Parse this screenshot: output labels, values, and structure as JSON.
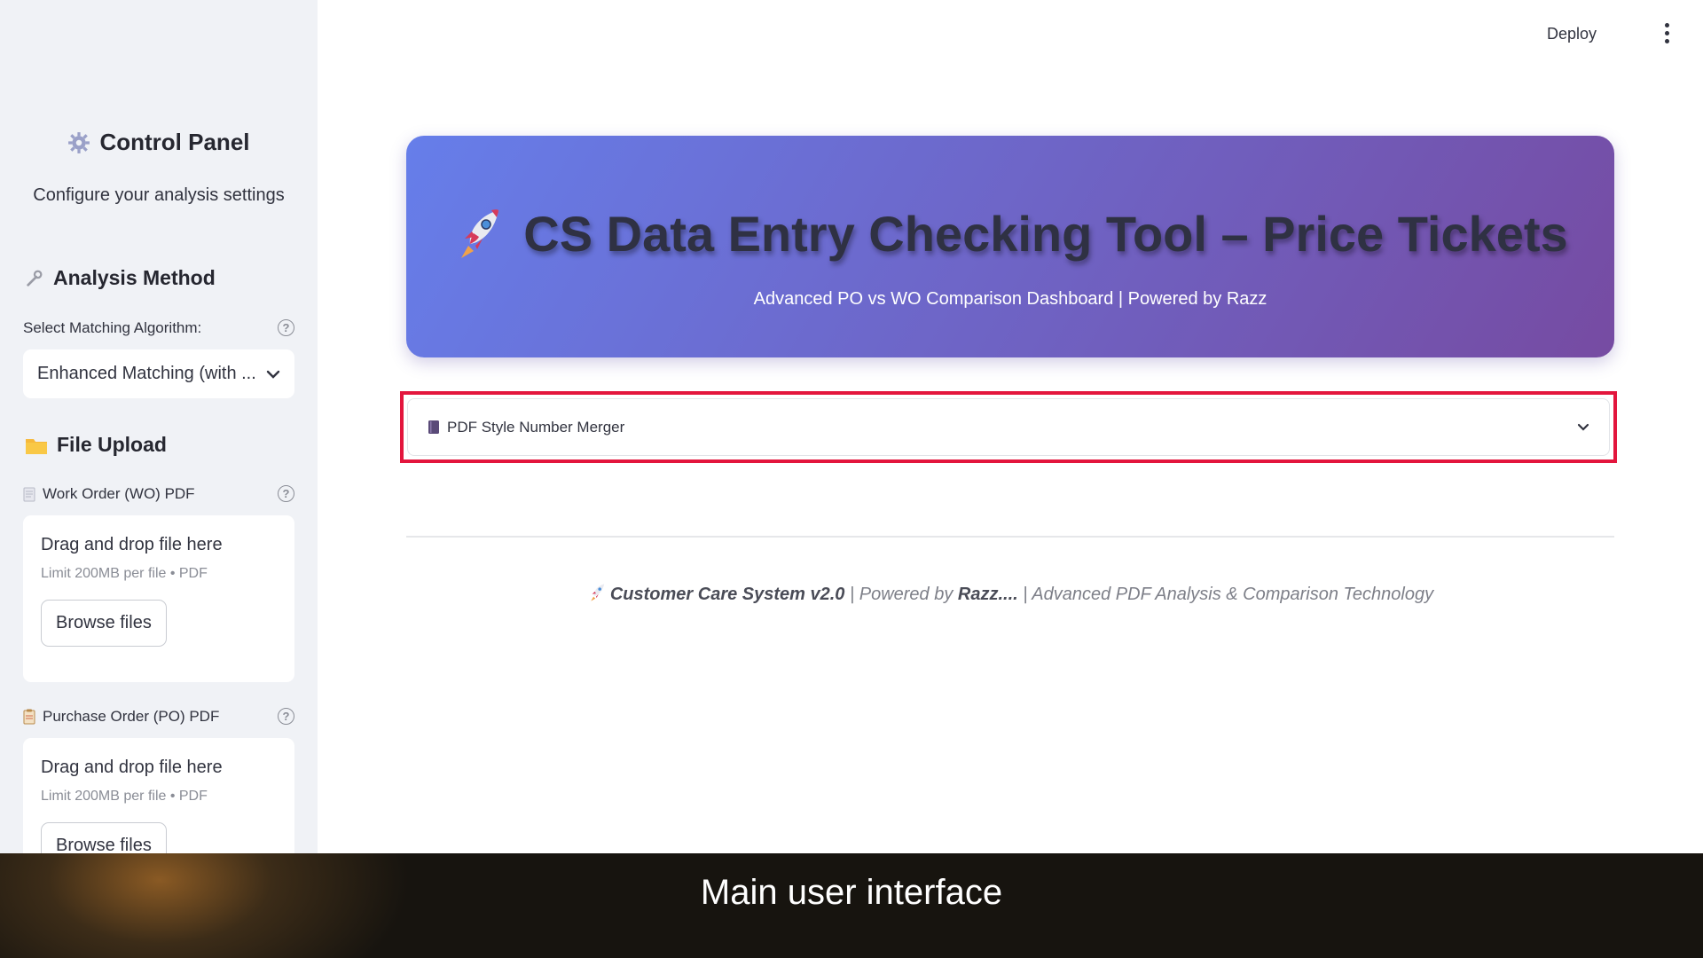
{
  "sidebar": {
    "title": "Control Panel",
    "subtitle": "Configure your analysis settings",
    "analysis_method": {
      "title": "Analysis Method",
      "select_label": "Select Matching Algorithm:",
      "selected_value": "Enhanced Matching (with ..."
    },
    "file_upload": {
      "title": "File Upload",
      "wo": {
        "label": "Work Order (WO) PDF",
        "drop_text": "Drag and drop file here",
        "limit_text": "Limit 200MB per file • PDF",
        "browse_label": "Browse files"
      },
      "po": {
        "label": "Purchase Order (PO) PDF",
        "drop_text": "Drag and drop file here",
        "limit_text": "Limit 200MB per file • PDF",
        "browse_label": "Browse files"
      }
    }
  },
  "header": {
    "deploy_label": "Deploy"
  },
  "hero": {
    "title": "CS Data Entry Checking Tool – Price Tickets",
    "subtitle": "Advanced PO vs WO Comparison Dashboard | Powered by Razz"
  },
  "expander": {
    "label": "PDF Style Number Merger"
  },
  "footer": {
    "system": "Customer Care System v2.0",
    "powered_prefix": " | Powered by ",
    "powered_name": "Razz....",
    "tail": " | Advanced PDF Analysis & Comparison Technology"
  },
  "caption": {
    "text": "Main user interface"
  },
  "colors": {
    "hero_gradient_start": "#667eea",
    "hero_gradient_end": "#764ba2",
    "highlight": "#e3163d",
    "sidebar_bg": "#f0f2f6"
  }
}
